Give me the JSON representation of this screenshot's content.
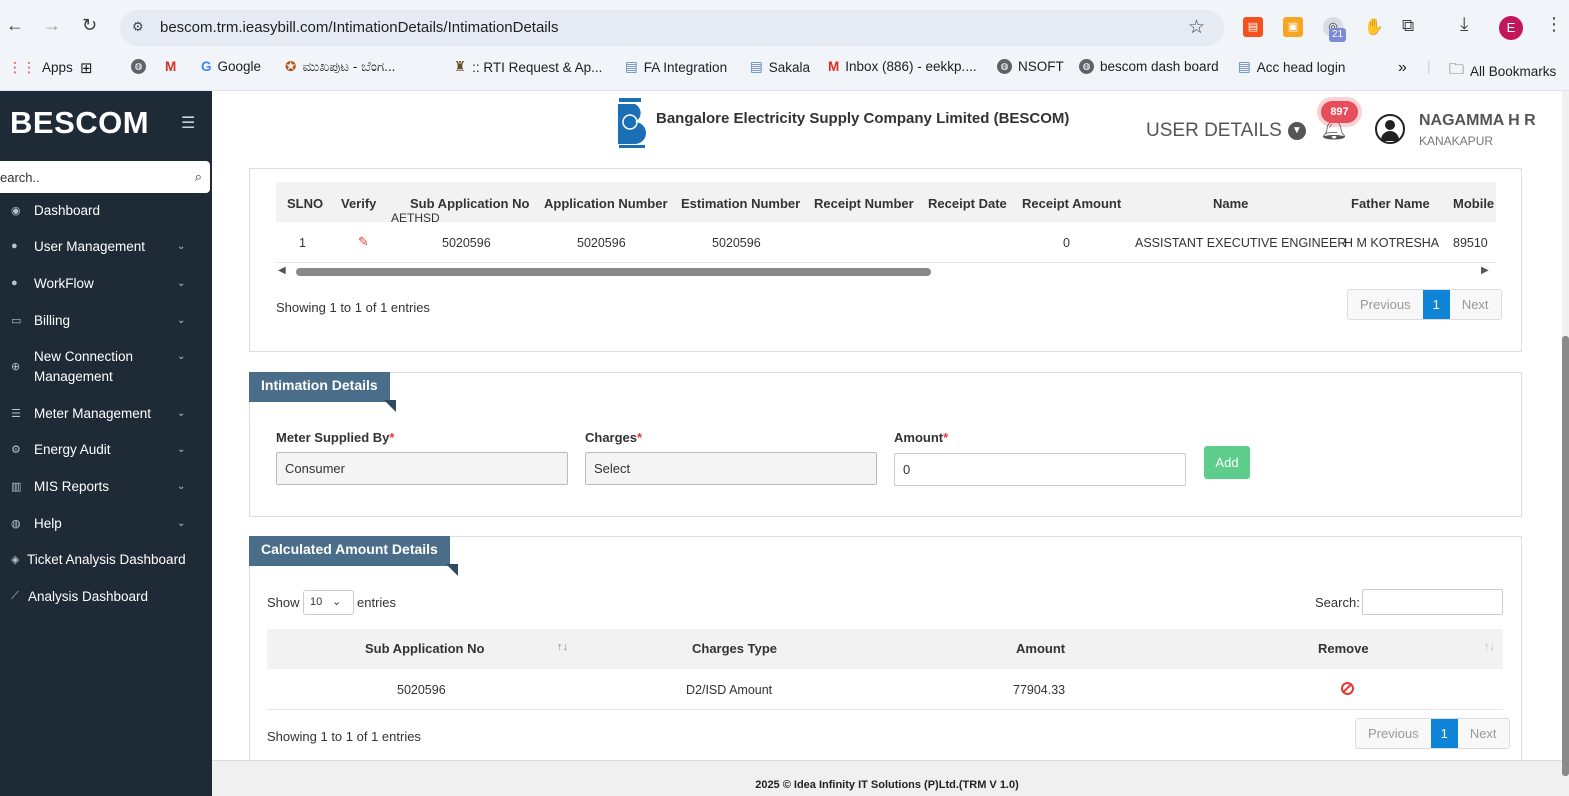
{
  "browser": {
    "url": "bescom.trm.ieasybill.com/IntimationDetails/IntimationDetails",
    "ext_badge": "21",
    "profile_initial": "E",
    "bookmarks": [
      "Apps",
      "Google",
      "ಮುಖಪುಟ - ಬೆಂಗ...",
      ":: RTI Request & Ap...",
      "FA Integration",
      "Sakala",
      "Inbox (886) - eekkp....",
      "NSOFT",
      "bescom dash board",
      "Acc head login"
    ],
    "more": "»",
    "all_bookmarks": "All Bookmarks"
  },
  "sidebar": {
    "brand": "BESCOM",
    "search_placeholder": "earch..",
    "items": [
      "Dashboard",
      "User Management",
      "WorkFlow",
      "Billing",
      "New Connection",
      "Management",
      "Meter Management",
      "Energy Audit",
      "MIS Reports",
      "Help",
      "Ticket Analysis Dashboard",
      "Analysis Dashboard"
    ]
  },
  "header": {
    "company": "Bangalore Electricity Supply Company Limited (BESCOM)",
    "user_details": "USER DETAILS",
    "notifications": "897",
    "user_name": "NAGAMMA H R",
    "user_location": "KANAKAPUR"
  },
  "app_table": {
    "columns": [
      "SLNO",
      "Verify",
      "Sub Application No",
      "Application Number",
      "Estimation Number",
      "Receipt Number",
      "Receipt Date",
      "Receipt Amount",
      "Name",
      "Father Name",
      "Mobile"
    ],
    "tooltip": "AETHSD",
    "row": {
      "slno": "1",
      "sub_app": "5020596",
      "app_no": "5020596",
      "est_no": "5020596",
      "receipt_amount": "0",
      "name": "ASSISTANT EXECUTIVE ENGINEER",
      "father": "H M KOTRESHA",
      "mobile": "89510"
    },
    "info": "Showing 1 to 1 of 1 entries",
    "prev": "Previous",
    "page": "1",
    "next": "Next"
  },
  "intimation": {
    "title": "Intimation Details",
    "meter_label": "Meter Supplied By",
    "meter_value": "Consumer",
    "charges_label": "Charges",
    "charges_value": "Select",
    "amount_label": "Amount",
    "amount_value": "0",
    "required": "*",
    "add": "Add"
  },
  "calc": {
    "title": "Calculated Amount Details",
    "show": "Show",
    "page_size": "10",
    "entries": "entries",
    "search": "Search:",
    "columns": [
      "Sub Application No",
      "Charges Type",
      "Amount",
      "Remove"
    ],
    "row": {
      "sub_app": "5020596",
      "charges_type": "D2/ISD Amount",
      "amount": "77904.33"
    },
    "info": "Showing 1 to 1 of 1 entries",
    "prev": "Previous",
    "page": "1",
    "next": "Next"
  },
  "footer": "2025 © Idea Infinity IT Solutions (P)Ltd.(TRM V 1.0)"
}
